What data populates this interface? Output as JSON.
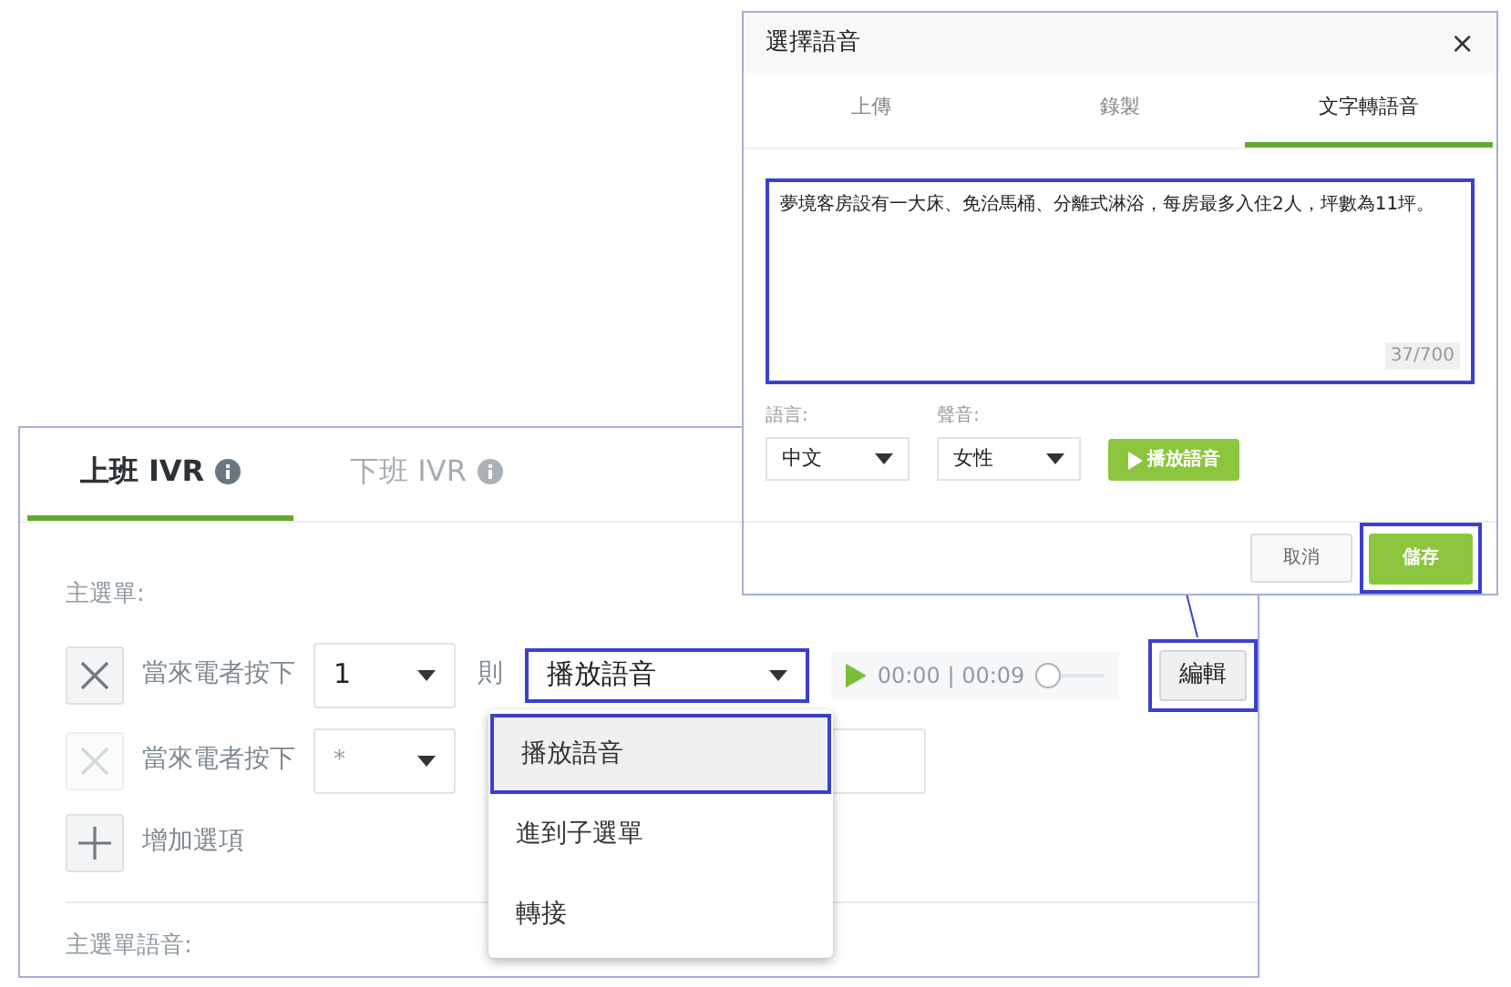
{
  "main_panel": {
    "tabs": [
      {
        "label": "上班 IVR",
        "selected": true
      },
      {
        "label": "下班 IVR",
        "selected": false
      }
    ],
    "section_label": "主選單:",
    "rules": [
      {
        "remove_disabled": false,
        "prefix": "當來電者按下",
        "key": "1",
        "key_set": true,
        "then": "則",
        "action": "播放語音",
        "highlighted": true,
        "player": {
          "time": "00:00 | 00:09",
          "level": 0
        },
        "edit_button": "編輯"
      },
      {
        "remove_disabled": true,
        "prefix": "當來電者按下",
        "key": "*",
        "key_set": false
      }
    ],
    "add_option": "增加選項",
    "voice_section_label": "主選單語音:"
  },
  "dropdown": {
    "options": [
      {
        "label": "播放語音",
        "selected": true
      },
      {
        "label": "進到子選單",
        "selected": false
      },
      {
        "label": "轉接",
        "selected": false
      }
    ]
  },
  "dialog": {
    "title": "選擇語音",
    "close": "×",
    "tabs": [
      {
        "label": "上傳",
        "selected": false
      },
      {
        "label": "錄製",
        "selected": false
      },
      {
        "label": "文字轉語音",
        "selected": true
      }
    ],
    "text": "夢境客房設有一大床、免治馬桶、分離式淋浴，每房最多入住2人，坪數為11坪。",
    "count": "37/700",
    "language_label": "語言:",
    "language": "中文",
    "voice_label": "聲音:",
    "voice": "女性",
    "play_button": "播放語音",
    "cancel_button": "取消",
    "save_button": "儲存"
  }
}
